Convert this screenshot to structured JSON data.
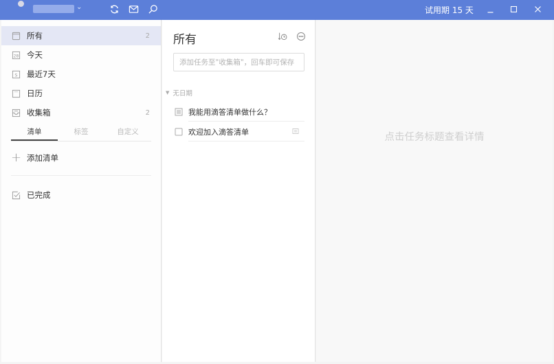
{
  "titlebar": {
    "username_masked": "",
    "trial_label": "试用期 15 天",
    "icons": [
      "sync-icon",
      "mail-icon",
      "search-icon"
    ],
    "window_buttons": [
      "minimize",
      "maximize",
      "close"
    ]
  },
  "sidebar": {
    "items": [
      {
        "label": "所有",
        "count": "2",
        "icon": "all-icon",
        "active": true
      },
      {
        "label": "今天",
        "count": "",
        "icon": "today-calendar-icon",
        "icon_text": "28"
      },
      {
        "label": "最近7天",
        "count": "",
        "icon": "next-7-days-icon",
        "icon_text": "S"
      },
      {
        "label": "日历",
        "count": "",
        "icon": "calendar-icon"
      },
      {
        "label": "收集箱",
        "count": "2",
        "icon": "inbox-icon"
      }
    ],
    "tabs": [
      {
        "label": "清单",
        "active": true
      },
      {
        "label": "标签",
        "active": false
      },
      {
        "label": "自定义",
        "active": false
      }
    ],
    "add_list_label": "添加清单",
    "completed_label": "已完成"
  },
  "list": {
    "title": "所有",
    "input_placeholder": "添加任务至\"收集箱\"，回车即可保存",
    "group_label": "无日期",
    "tasks": [
      {
        "title": "我能用滴答清单做什么？",
        "type": "note"
      },
      {
        "title": "欢迎加入滴答清单",
        "type": "checkbox",
        "has_note": true
      }
    ]
  },
  "detail": {
    "hint": "点击任务标题查看详情"
  },
  "colors": {
    "titlebar": "#5c7fd9",
    "active_nav": "#e4e7f5"
  }
}
